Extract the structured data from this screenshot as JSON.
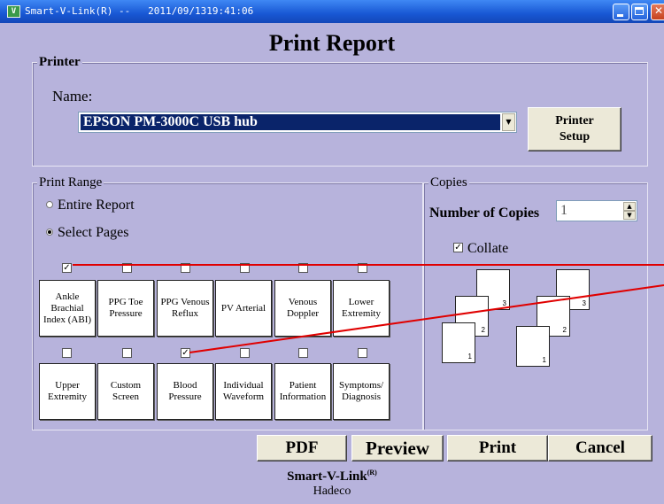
{
  "window": {
    "icon_text": "V",
    "title": "Smart-V-Link(R) --   2011/09/1319:41:06"
  },
  "page_title": "Print Report",
  "printer": {
    "group_label": "Printer",
    "name_label": "Name:",
    "selected_printer": "EPSON PM-3000C USB hub",
    "setup_label_line1": "Printer",
    "setup_label_line2": "Setup"
  },
  "print_range": {
    "group_label": "Print Range",
    "entire_report_label": "Entire Report",
    "select_pages_label": "Select Pages",
    "selected_mode": "Select Pages",
    "pages": [
      {
        "label": "Ankle Brachial Index (ABI)",
        "checked": true
      },
      {
        "label": "PPG Toe Pressure",
        "checked": false
      },
      {
        "label": "PPG Venous Reflux",
        "checked": false
      },
      {
        "label": "PV Arterial",
        "checked": false
      },
      {
        "label": "Venous Doppler",
        "checked": false
      },
      {
        "label": "Lower Extremity",
        "checked": false
      },
      {
        "label": "Upper Extremity",
        "checked": false
      },
      {
        "label": "Custom Screen",
        "checked": false
      },
      {
        "label": "Blood Pressure",
        "checked": true
      },
      {
        "label": "Individual Waveform",
        "checked": false
      },
      {
        "label": "Patient Information",
        "checked": false
      },
      {
        "label": "Symptoms/ Diagnosis",
        "checked": false
      }
    ]
  },
  "copies": {
    "group_label": "Copies",
    "number_label": "Number of Copies",
    "number_value": "1",
    "collate_label": "Collate",
    "collate_checked": true,
    "sheet_numbers": [
      "1",
      "2",
      "3",
      "1",
      "2",
      "3"
    ]
  },
  "buttons": {
    "pdf": "PDF",
    "preview": "Preview",
    "print": "Print",
    "cancel": "Cancel"
  },
  "footer": {
    "product": "Smart-V-Link",
    "registered": "(R)",
    "company": "Hadeco"
  },
  "colors": {
    "window_bg": "#b7b3dc",
    "titlebar": "#1857d4",
    "selection": "#0a246a",
    "annotation_line": "#e00000"
  },
  "icons": {
    "dropdown": "chevron-down-icon",
    "check": "checkmark-icon",
    "minimize": "minimize-icon",
    "maximize": "maximize-icon",
    "close": "close-icon"
  }
}
